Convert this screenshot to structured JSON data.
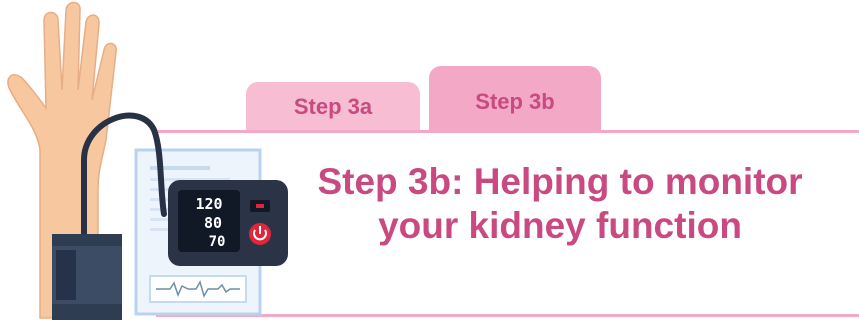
{
  "tabs": [
    {
      "label": "Step 3a",
      "active": false
    },
    {
      "label": "Step 3b",
      "active": true
    }
  ],
  "content": {
    "heading": "Step 3b: Helping to monitor your kidney function"
  },
  "monitor": {
    "systolic": "120",
    "diastolic": "80",
    "pulse": "70"
  },
  "colors": {
    "accent_text": "#c84a80",
    "tab_inactive": "#f6bdd3",
    "tab_active": "#f3a8c6",
    "rule": "#f3a8c6"
  },
  "icons": [
    "raised-hand-icon",
    "clipboard-report-icon",
    "blood-pressure-monitor-icon",
    "power-icon",
    "cuff-icon"
  ]
}
